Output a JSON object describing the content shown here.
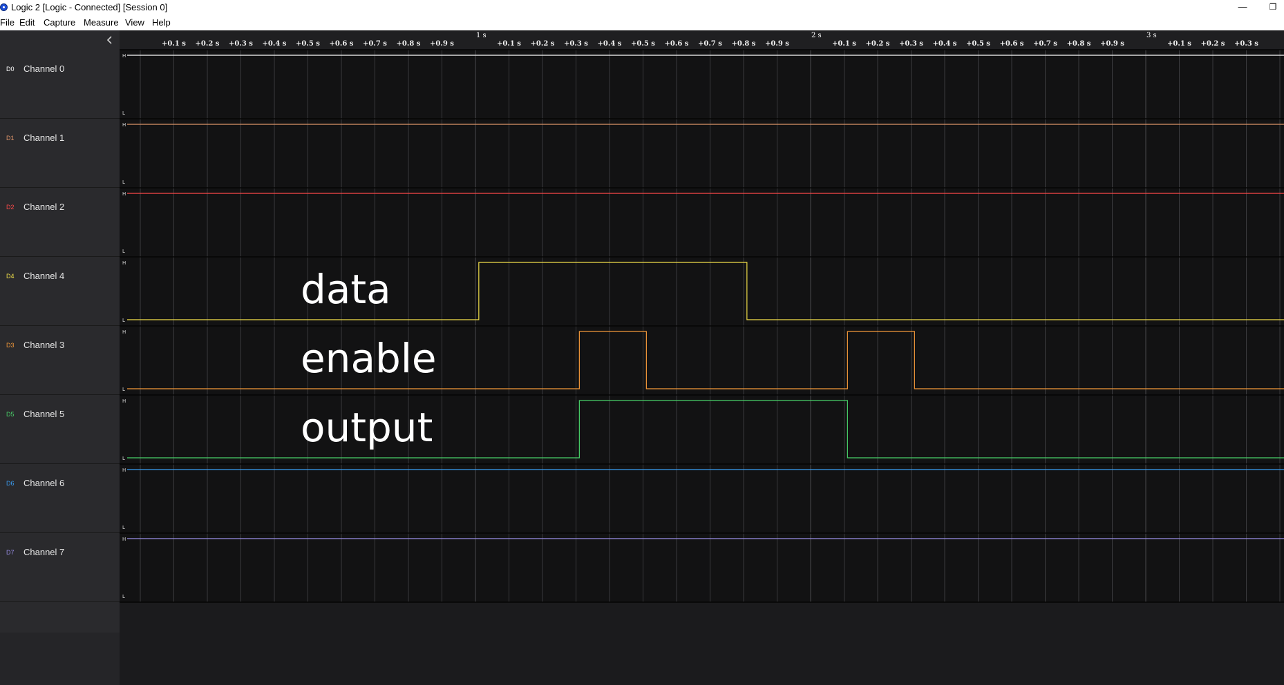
{
  "window": {
    "title": "Logic 2 [Logic - Connected] [Session 0]",
    "minimize_glyph": "—",
    "restore_glyph": "❐"
  },
  "menu": [
    "File",
    "Edit",
    "Capture",
    "Measure",
    "View",
    "Help"
  ],
  "sidebar": {
    "collapse_icon": "chevron-left-icon",
    "channels": [
      {
        "id": "D0",
        "name": "Channel 0",
        "color": "#ffffff",
        "level": "high"
      },
      {
        "id": "D1",
        "name": "Channel 1",
        "color": "#e0956a",
        "level": "high"
      },
      {
        "id": "D2",
        "name": "Channel 2",
        "color": "#ff4a4a",
        "level": "high"
      },
      {
        "id": "D4",
        "name": "Channel 4",
        "color": "#f2e04a",
        "level": "low"
      },
      {
        "id": "D3",
        "name": "Channel 3",
        "color": "#f59a3a",
        "level": "low"
      },
      {
        "id": "D5",
        "name": "Channel 5",
        "color": "#4ad46a",
        "level": "low"
      },
      {
        "id": "D6",
        "name": "Channel 6",
        "color": "#3a9ef5",
        "level": "high"
      },
      {
        "id": "D7",
        "name": "Channel 7",
        "color": "#9a90e8",
        "level": "high"
      }
    ]
  },
  "ruler": {
    "major": [
      {
        "label": "1 s",
        "t": 1
      },
      {
        "label": "2 s",
        "t": 2
      },
      {
        "label": "3 s",
        "t": 3
      }
    ],
    "minor_labels": [
      "+0.1 s",
      "+0.2 s",
      "+0.3 s",
      "+0.4 s",
      "+0.5 s",
      "+0.6 s",
      "+0.7 s",
      "+0.8 s",
      "+0.9 s"
    ],
    "visible_range_s": [
      0,
      3.45
    ]
  },
  "level_labels": {
    "high": "H",
    "low": "L"
  },
  "annotations": [
    {
      "channel_index": 3,
      "text": "data"
    },
    {
      "channel_index": 4,
      "text": "enable"
    },
    {
      "channel_index": 5,
      "text": "output"
    }
  ],
  "waveforms": [
    {
      "channel_index": 3,
      "transitions_s": [
        {
          "t": 1.01,
          "level": "high"
        },
        {
          "t": 1.81,
          "level": "low"
        }
      ]
    },
    {
      "channel_index": 4,
      "transitions_s": [
        {
          "t": 1.31,
          "level": "high"
        },
        {
          "t": 1.51,
          "level": "low"
        },
        {
          "t": 2.11,
          "level": "high"
        },
        {
          "t": 2.31,
          "level": "low"
        }
      ]
    },
    {
      "channel_index": 5,
      "transitions_s": [
        {
          "t": 1.31,
          "level": "high"
        },
        {
          "t": 2.11,
          "level": "low"
        }
      ]
    }
  ],
  "colors": {
    "plot_bg": "#121213",
    "plot_empty_bg": "#1b1b1d",
    "ruler_bg": "#1f1f21",
    "grid": "#3a3a3d",
    "sidebar_bg": "#2a2a2d"
  }
}
